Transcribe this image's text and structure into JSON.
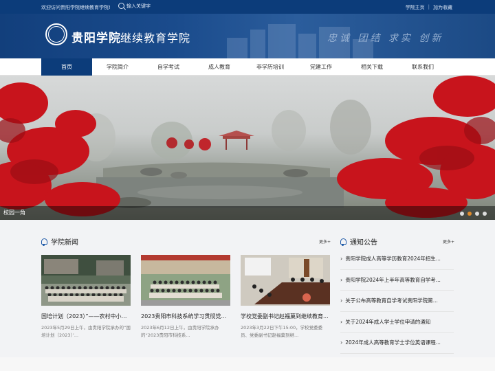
{
  "topbar": {
    "welcome": "欢迎访问贵阳学院继续教育学院!",
    "search_placeholder": "输入关键字",
    "links": [
      "学院主页",
      "加为收藏"
    ],
    "separator": "|"
  },
  "header": {
    "logo_name": "贵阳学院",
    "logo_sub": "继续教育学院",
    "motto": "忠诚 团结 求实 创新"
  },
  "nav": {
    "items": [
      "首页",
      "学院简介",
      "自学考试",
      "成人教育",
      "非学历培训",
      "党建工作",
      "相关下载",
      "联系我们"
    ],
    "active_index": 0
  },
  "banner": {
    "caption": "校园一角",
    "slide_count": 4,
    "active_slide": 2
  },
  "news": {
    "title": "学院新闻",
    "more": "更多+",
    "items": [
      {
        "title": "国培计划（2023）”——农村中小学...",
        "desc": "2023年5月29日上午，由贵阳学院承办的“国培计划（2023）’..."
      },
      {
        "title": "2023贵阳市科技系统学习贯彻党的...",
        "desc": "2023年6月12日上午，由贵阳学院承办的“2023贵阳市科技系..."
      },
      {
        "title": "学校党委副书记赵福菓到继续教育...",
        "desc": "2023年3月22日下午15:00，学校党委委员、党委副书记赵福菓到继..."
      }
    ]
  },
  "notice": {
    "title": "通知公告",
    "more": "更多+",
    "items": [
      "贵阳学院成人高等学历教育2024年招生...",
      "贵阳学院2024年上半年高等教育自学考...",
      "关于公布高等教育自学考试贵阳学院第...",
      "关于2024年成人学士学位申请的通知",
      "2024年成人高等教育学士学位英语课程..."
    ]
  },
  "colors": {
    "primary": "#0c3c7a",
    "accent_dot": "#e08a2a",
    "maple": "#c8141c"
  }
}
